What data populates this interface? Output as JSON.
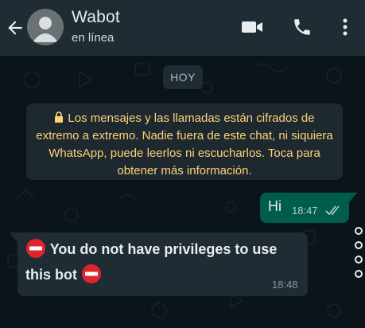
{
  "header": {
    "contact_name": "Wabot",
    "status": "en línea",
    "icons": [
      "back-arrow-icon",
      "avatar-icon",
      "video-call-icon",
      "phone-icon",
      "more-vert-icon"
    ]
  },
  "chat": {
    "date_chip": "HOY",
    "encryption_notice": "Los mensajes y las llamadas están cifrados de extremo a extremo. Nadie fuera de este chat, ni siquiera WhatsApp, puede leerlos ni escucharlos. Toca para obtener más información.",
    "messages": [
      {
        "direction": "outgoing",
        "text": "Hi",
        "time": "18:47",
        "status": "read"
      },
      {
        "direction": "incoming",
        "text": "You do not have privileges to use this bot",
        "time": "18:48"
      }
    ]
  },
  "colors": {
    "header_bg": "#1f2c34",
    "chat_bg": "#0b141a",
    "outgoing_bubble": "#005c4b",
    "incoming_bubble": "#1f2c34",
    "notice_text": "#ffd279",
    "no_entry_red": "#e0242b"
  }
}
